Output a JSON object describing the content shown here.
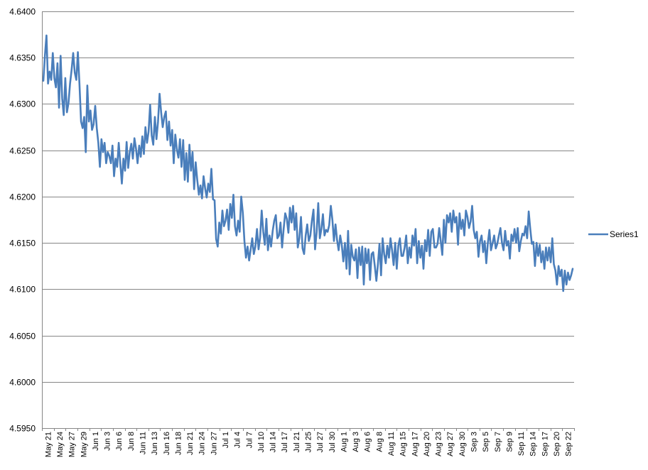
{
  "chart_data": {
    "type": "line",
    "title": "",
    "xlabel": "",
    "ylabel": "",
    "ylim": [
      4.595,
      4.64
    ],
    "yticks": [
      "4.5950",
      "4.6000",
      "4.6050",
      "4.6100",
      "4.6150",
      "4.6200",
      "4.6250",
      "4.6300",
      "4.6350",
      "4.6400"
    ],
    "grid": "horizontal",
    "legend_position": "right",
    "x_labels": [
      "May 21",
      "May 24",
      "May 27",
      "May 29",
      "Jun 1",
      "Jun 3",
      "Jun 6",
      "Jun 8",
      "Jun 11",
      "Jun 13",
      "Jun 16",
      "Jun 18",
      "Jun 21",
      "Jun 24",
      "Jun 27",
      "Jul 1",
      "Jul 4",
      "Jul 7",
      "Jul 10",
      "Jul 14",
      "Jul 17",
      "Jul 21",
      "Jul 25",
      "Jul 27",
      "Jul 30",
      "Aug 1",
      "Aug 3",
      "Aug 6",
      "Aug 8",
      "Aug 11",
      "Aug 15",
      "Aug 17",
      "Aug 20",
      "Aug 23",
      "Aug 27",
      "Aug 30",
      "Sep 3",
      "Sep 5",
      "Sep 7",
      "Sep 9",
      "Sep 11",
      "Sep 14",
      "Sep 17",
      "Sep 20",
      "Sep 22"
    ],
    "series": [
      {
        "name": "Series1",
        "color": "#4a7ebb",
        "values": [
          4.6325,
          4.6352,
          4.6374,
          4.6322,
          4.6335,
          4.6326,
          4.6355,
          4.6328,
          4.6318,
          4.6344,
          4.6296,
          4.6352,
          4.6306,
          4.6288,
          4.6328,
          4.6291,
          4.6301,
          4.6322,
          4.6337,
          4.6355,
          4.6334,
          4.6326,
          4.6356,
          4.6322,
          4.6281,
          4.6274,
          4.6286,
          4.6248,
          4.632,
          4.6281,
          4.6293,
          4.6272,
          4.6278,
          4.6298,
          4.6274,
          4.6258,
          4.6232,
          4.6262,
          4.6248,
          4.6258,
          4.6236,
          4.6248,
          4.6244,
          4.6236,
          4.6255,
          4.6222,
          4.6241,
          4.6232,
          4.6258,
          4.6236,
          4.6214,
          4.6241,
          4.6228,
          4.6259,
          4.6231,
          4.6248,
          4.6257,
          4.6241,
          4.6263,
          4.6252,
          4.6236,
          4.6255,
          4.6243,
          4.6265,
          4.6246,
          4.6275,
          4.6258,
          4.627,
          4.6299,
          4.6266,
          4.6256,
          4.6286,
          4.6262,
          4.6281,
          4.6311,
          4.6291,
          4.6275,
          4.6286,
          4.6292,
          4.6261,
          4.6281,
          4.6255,
          4.6272,
          4.6236,
          4.6267,
          4.6251,
          4.6242,
          4.6262,
          4.6232,
          4.6261,
          4.6218,
          4.6247,
          4.6216,
          4.6256,
          4.6228,
          4.6248,
          4.6208,
          4.6237,
          4.6218,
          4.6202,
          4.6212,
          4.6198,
          4.6222,
          4.6209,
          4.6199,
          4.6214,
          4.6205,
          4.623,
          4.6197,
          4.6196,
          4.6154,
          4.6146,
          4.6172,
          4.616,
          4.6185,
          4.6168,
          4.6174,
          4.6186,
          4.6164,
          4.6192,
          4.6177,
          4.6202,
          4.6168,
          4.6158,
          4.6174,
          4.6162,
          4.62,
          4.6182,
          4.6152,
          4.6134,
          4.6146,
          4.6131,
          4.6143,
          4.6155,
          4.6138,
          4.6146,
          4.6165,
          4.6143,
          4.6156,
          4.6185,
          4.6162,
          4.6148,
          4.6176,
          4.6142,
          4.6158,
          4.6146,
          4.6163,
          4.6174,
          4.618,
          4.6155,
          4.6158,
          4.6172,
          4.6145,
          4.6165,
          4.6182,
          4.6176,
          4.6161,
          4.6188,
          4.6172,
          4.619,
          4.6164,
          4.6182,
          4.6145,
          4.6155,
          4.6178,
          4.6144,
          4.6138,
          4.6158,
          4.617,
          4.6152,
          4.6158,
          4.6174,
          4.6186,
          4.6143,
          4.6162,
          4.6193,
          4.6155,
          4.6165,
          4.6181,
          4.6158,
          4.6164,
          4.6162,
          4.6169,
          4.619,
          4.6175,
          4.6152,
          4.617,
          4.6153,
          4.6142,
          4.6158,
          4.6148,
          4.613,
          4.615,
          4.6122,
          4.6163,
          4.6116,
          4.6148,
          4.6135,
          4.6131,
          4.6143,
          4.6112,
          4.6145,
          4.6126,
          4.6146,
          4.6105,
          4.6144,
          4.6128,
          4.6143,
          4.611,
          4.6138,
          4.614,
          4.6125,
          4.6109,
          4.6127,
          4.6149,
          4.6115,
          4.6155,
          4.6138,
          4.6128,
          4.6147,
          4.6134,
          4.6155,
          4.6142,
          4.6126,
          4.615,
          4.6122,
          4.6147,
          4.6155,
          4.6136,
          4.6136,
          4.6145,
          4.6158,
          4.6128,
          4.6145,
          4.6134,
          4.6158,
          4.6147,
          4.6165,
          4.6128,
          4.6152,
          4.6134,
          4.6147,
          4.6122,
          4.6153,
          4.6141,
          4.6164,
          4.6136,
          4.6162,
          4.6165,
          4.6145,
          4.6145,
          4.6149,
          4.6166,
          4.6152,
          4.6137,
          4.6175,
          4.615,
          4.618,
          4.6172,
          4.6182,
          4.6162,
          4.6185,
          4.6172,
          4.6178,
          4.6148,
          4.6182,
          4.6165,
          4.6175,
          4.6158,
          4.6185,
          4.6178,
          4.6166,
          4.6173,
          4.619,
          4.6164,
          4.6155,
          4.6162,
          4.6135,
          4.6152,
          4.6158,
          4.614,
          4.6152,
          4.6128,
          4.615,
          4.6164,
          4.6142,
          4.615,
          4.6158,
          4.6144,
          4.6149,
          4.6158,
          4.6166,
          4.615,
          4.6142,
          4.6163,
          4.6147,
          4.6152,
          4.6133,
          4.6159,
          4.6152,
          4.6165,
          4.615,
          4.6166,
          4.6141,
          4.6152,
          4.616,
          4.6158,
          4.6168,
          4.6155,
          4.6184,
          4.6165,
          4.6149,
          4.6151,
          4.6125,
          4.615,
          4.6136,
          4.6148,
          4.6129,
          4.6141,
          4.6122,
          4.6145,
          4.6131,
          4.6145,
          4.6129,
          4.6155,
          4.6127,
          4.612,
          4.6105,
          4.6125,
          4.6114,
          4.6121,
          4.6098,
          4.612,
          4.6105,
          4.6118,
          4.611,
          4.6115,
          4.6122
        ]
      }
    ]
  }
}
